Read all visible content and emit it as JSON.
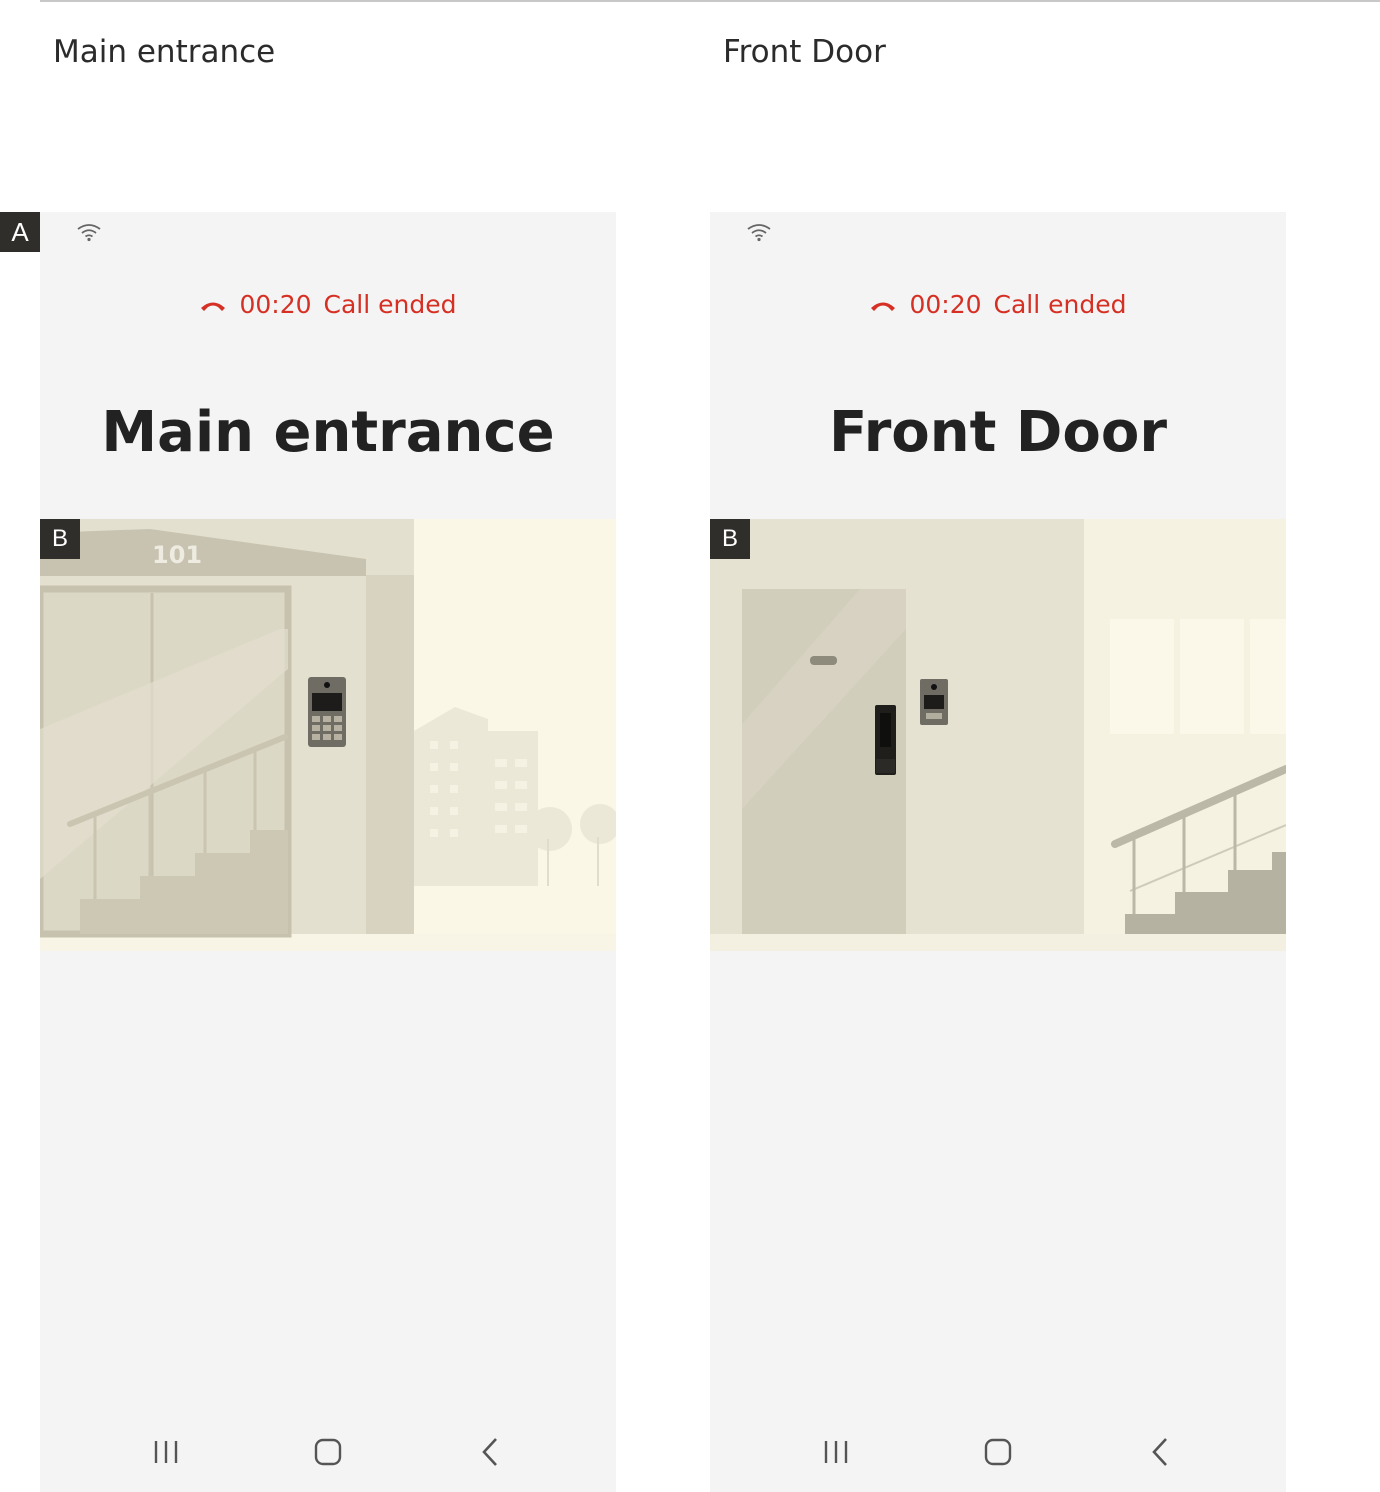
{
  "captions": {
    "left": "Main entrance",
    "right": "Front Door"
  },
  "badges": {
    "a": "A",
    "b": "B"
  },
  "phones": [
    {
      "call_time": "00:20",
      "call_status": "Call ended",
      "title": "Main entrance",
      "scene": "lobby-with-elevator-and-intercom",
      "building_number": "101"
    },
    {
      "call_time": "00:20",
      "call_status": "Call ended",
      "title": "Front Door",
      "scene": "apartment-door-with-doorbell-camera"
    }
  ],
  "colors": {
    "status_red": "#d62f23",
    "screen_bg": "#f4f4f4",
    "badge_bg": "#2f2e2a"
  },
  "icons": {
    "status": "wifi-icon",
    "call": "hangup-icon",
    "nav": [
      "recents-icon",
      "home-icon",
      "back-icon"
    ]
  }
}
